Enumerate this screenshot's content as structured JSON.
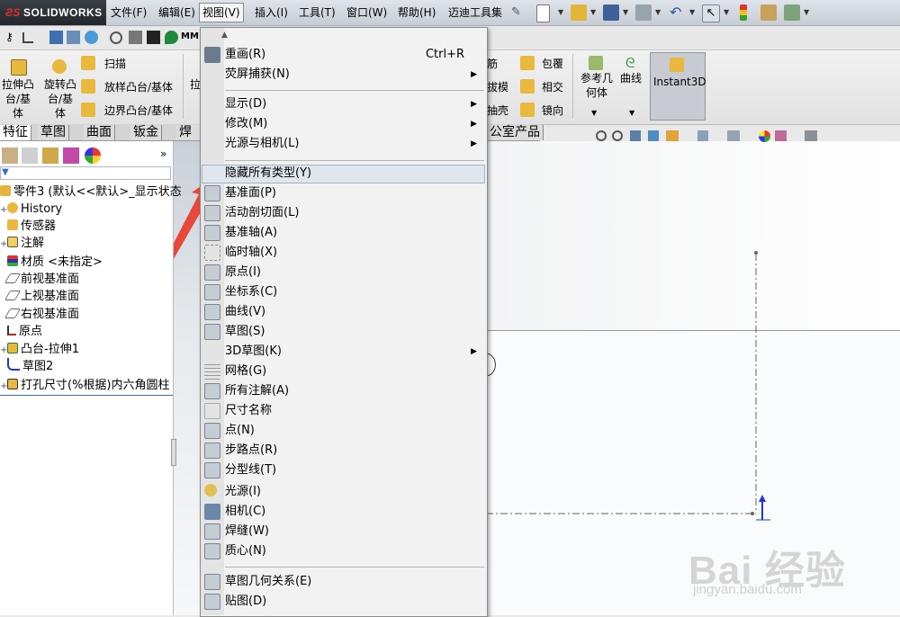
{
  "app": {
    "name": "SOLIDWORKS"
  },
  "menubar": {
    "items": [
      {
        "label": "文件(F)"
      },
      {
        "label": "编辑(E)"
      },
      {
        "label": "视图(V)"
      },
      {
        "label": "插入(I)"
      },
      {
        "label": "工具(T)"
      },
      {
        "label": "窗口(W)"
      },
      {
        "label": "帮助(H)"
      },
      {
        "label": "迈迪工具集"
      }
    ]
  },
  "command_manager": {
    "extrude_boss": "拉伸凸台/基体",
    "revolve_boss": "旋转凸台/基体",
    "sweep": "扫描",
    "loft": "放样凸台/基体",
    "boundary": "边界凸台/基体",
    "rib": "筋",
    "wrap": "包覆",
    "draft": "拔模",
    "intersect": "相交",
    "shell": "抽壳",
    "mirror": "镜向",
    "ref_geometry": "参考几何体",
    "curves": "曲线",
    "instant3d": "Instant3D",
    "partial_left": "拉"
  },
  "tabs": [
    {
      "label": "特征"
    },
    {
      "label": "草图"
    },
    {
      "label": "曲面"
    },
    {
      "label": "钣金"
    },
    {
      "label": "焊件"
    }
  ],
  "tab_tail": "公室产品",
  "tree": {
    "root": "零件3 (默认<<默认>_显示状态",
    "items": [
      {
        "label": "History"
      },
      {
        "label": "传感器"
      },
      {
        "label": "注解"
      },
      {
        "label": "材质 <未指定>"
      },
      {
        "label": "前视基准面"
      },
      {
        "label": "上视基准面"
      },
      {
        "label": "右视基准面"
      },
      {
        "label": "原点"
      },
      {
        "label": "凸台-拉伸1"
      },
      {
        "label": "草图2"
      },
      {
        "label": "打孔尺寸(%根据)内六角圆柱"
      }
    ]
  },
  "view_menu": {
    "items": [
      {
        "label": "重画(R)",
        "shortcut": "Ctrl+R"
      },
      {
        "label": "荧屏捕获(N)",
        "submenu": "▶"
      },
      {
        "label": "显示(D)",
        "submenu": "▶"
      },
      {
        "label": "修改(M)",
        "submenu": "▶"
      },
      {
        "label": "光源与相机(L)",
        "submenu": "▶"
      },
      {
        "label": "隐藏所有类型(Y)"
      },
      {
        "label": "基准面(P)"
      },
      {
        "label": "活动剖切面(L)"
      },
      {
        "label": "基准轴(A)"
      },
      {
        "label": "临时轴(X)"
      },
      {
        "label": "原点(I)"
      },
      {
        "label": "坐标系(C)"
      },
      {
        "label": "曲线(V)"
      },
      {
        "label": "草图(S)"
      },
      {
        "label": "3D草图(K)",
        "submenu": "▶"
      },
      {
        "label": "网格(G)"
      },
      {
        "label": "所有注解(A)"
      },
      {
        "label": "尺寸名称"
      },
      {
        "label": "点(N)"
      },
      {
        "label": "步路点(R)"
      },
      {
        "label": "分型线(T)"
      },
      {
        "label": "光源(I)"
      },
      {
        "label": "相机(C)"
      },
      {
        "label": "焊缝(W)"
      },
      {
        "label": "质心(N)"
      },
      {
        "label": "草图几何关系(E)"
      },
      {
        "label": "贴图(D)"
      }
    ]
  },
  "watermark": {
    "text": "Bai 经验",
    "url_text": "jingyan.baidu.com"
  },
  "colors": {
    "accent": "#e8473c",
    "highlight": "#e0e6ee"
  }
}
